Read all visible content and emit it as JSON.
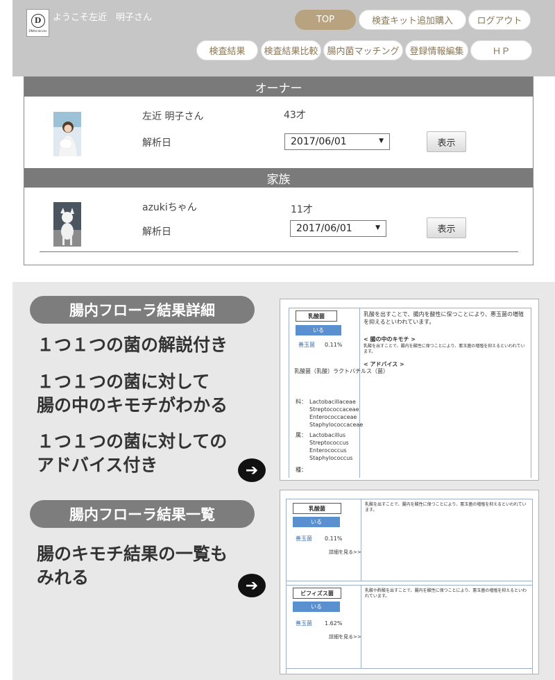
{
  "header": {
    "logo_text": "D",
    "logo_sub": "DNAsciences",
    "welcome": "ようこそ左近　明子さん",
    "nav_top": [
      "TOP",
      "検査キット追加購入",
      "ログアウト"
    ],
    "nav_bottom": [
      "検査結果",
      "検査結果比較",
      "腸内菌マッチング",
      "登録情報編集",
      "ＨＰ"
    ]
  },
  "owner": {
    "heading": "オーナー",
    "name": "左近 明子さん",
    "age": "43才",
    "date_label": "解析日",
    "date_value": "2017/06/01",
    "button": "表示"
  },
  "family": {
    "heading": "家族",
    "name": "azukiちゃん",
    "age": "11才",
    "date_label": "解析日",
    "date_value": "2017/06/01",
    "button": "表示"
  },
  "features": {
    "detail_pill": "腸内フローラ結果詳細",
    "detail_lines": [
      "１つ１つの菌の解説付き",
      "１つ１つの菌に対して",
      "腸の中のキモチがわかる",
      "１つ１つの菌に対しての",
      "アドバイス付き"
    ],
    "list_pill": "腸内フローラ結果一覧",
    "list_lines": [
      "腸のキモチ結果の一覧も",
      "みれる"
    ],
    "arrow_icon": "➔"
  },
  "detail_shot": {
    "bacteria_name": "乳酸菌",
    "status": "いる",
    "type_label": "善玉菌",
    "percent": "0.11%",
    "description": "乳酸を出すことで、腸内を酸性に保つことにより、悪玉菌の増殖を抑えるといわれています。",
    "kimochi_title": "< 腸の中のキモチ >",
    "kimochi_text": "乳酸を出すことで、腸内を酸性に保つことにより、悪玉菌の増殖を抑えるといわれています。",
    "advice_title": "< アドバイス >",
    "example_label": "乳酸菌（乳酸）ラクトバチルス（菌）",
    "family_label": "科：",
    "families": [
      "Lactobacillaceae",
      "Streptococcaceae",
      "Enterococcaceae",
      "Staphylococcaceae"
    ],
    "genus_label": "属：",
    "genera": [
      "Lactobacillus",
      "Streptococcus",
      "Enterococcus",
      "Staphylococcus"
    ],
    "species_label": "種："
  },
  "list_shot": {
    "items": [
      {
        "name": "乳酸菌",
        "status": "いる",
        "type": "善玉菌",
        "percent": "0.11%",
        "more": "詳細を見る>>",
        "text": "乳酸を出すことで、腸内を酸性に保つことにより、悪玉菌の増殖を抑えるといわれています。"
      },
      {
        "name": "ビフィズス菌",
        "status": "いる",
        "type": "善玉菌",
        "percent": "1.62%",
        "more": "詳細を見る>>",
        "text": "乳酸や酢酸を出すことで、腸内を酸性に保つことにより、悪玉菌の増殖を抑えるといわれています。"
      }
    ]
  }
}
